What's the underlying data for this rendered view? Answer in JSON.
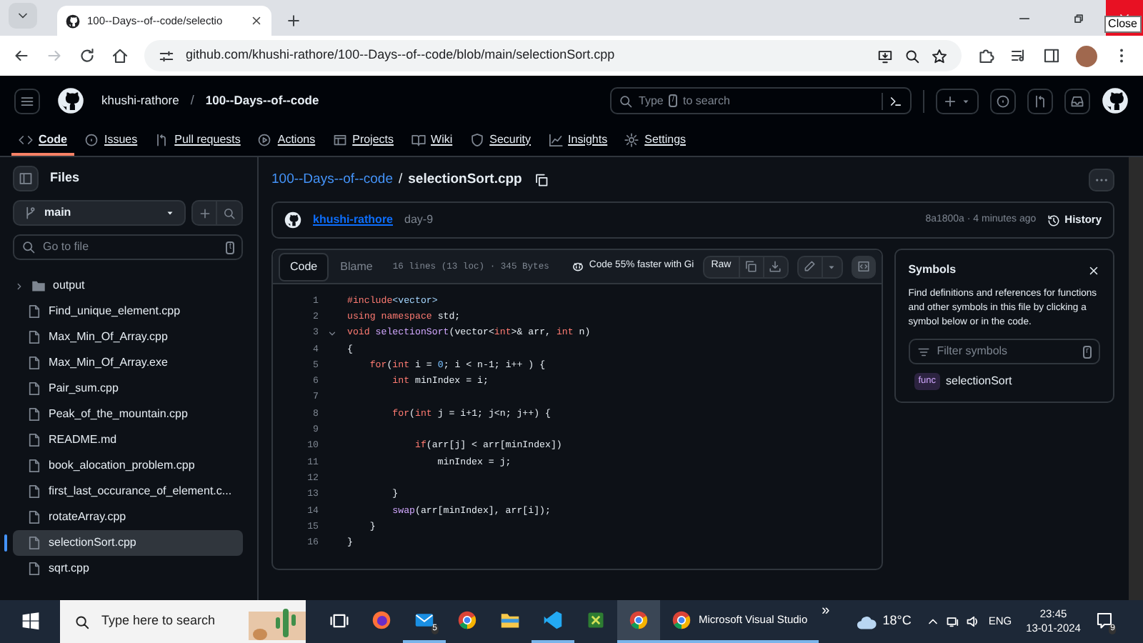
{
  "browser": {
    "tab_title": "100--Days--of--code/selectio",
    "url": "github.com/khushi-rathore/100--Days--of--code/blob/main/selectionSort.cpp",
    "close_tooltip": "Close"
  },
  "header": {
    "owner": "khushi-rathore",
    "separator": "/",
    "repo": "100--Days--of--code",
    "search": {
      "placeholder_before": "Type",
      "key": "/",
      "placeholder_after": "to search"
    }
  },
  "repo_tabs": [
    {
      "label": "Code",
      "selected": true
    },
    {
      "label": "Issues",
      "selected": false
    },
    {
      "label": "Pull requests",
      "selected": false
    },
    {
      "label": "Actions",
      "selected": false
    },
    {
      "label": "Projects",
      "selected": false
    },
    {
      "label": "Wiki",
      "selected": false
    },
    {
      "label": "Security",
      "selected": false
    },
    {
      "label": "Insights",
      "selected": false
    },
    {
      "label": "Settings",
      "selected": false
    }
  ],
  "sidebar": {
    "title": "Files",
    "branch": "main",
    "search": {
      "placeholder": "Go to file",
      "key": "t"
    },
    "tree": [
      {
        "name": "output",
        "kind": "folder",
        "expanded": false,
        "selected": false
      },
      {
        "name": "Find_unique_element.cpp",
        "kind": "file",
        "selected": false
      },
      {
        "name": "Max_Min_Of_Array.cpp",
        "kind": "file",
        "selected": false
      },
      {
        "name": "Max_Min_Of_Array.exe",
        "kind": "file",
        "selected": false
      },
      {
        "name": "Pair_sum.cpp",
        "kind": "file",
        "selected": false
      },
      {
        "name": "Peak_of_the_mountain.cpp",
        "kind": "file",
        "selected": false
      },
      {
        "name": "README.md",
        "kind": "file",
        "selected": false
      },
      {
        "name": "book_alocation_problem.cpp",
        "kind": "file",
        "selected": false
      },
      {
        "name": "first_last_occurance_of_element.c...",
        "kind": "file",
        "selected": false
      },
      {
        "name": "rotateArray.cpp",
        "kind": "file",
        "selected": false
      },
      {
        "name": "selectionSort.cpp",
        "kind": "file",
        "selected": true
      },
      {
        "name": "sqrt.cpp",
        "kind": "file",
        "selected": false
      }
    ]
  },
  "breadcrumb": {
    "repo": "100--Days--of--code",
    "separator": "/",
    "file": "selectionSort.cpp"
  },
  "commit": {
    "author": "khushi-rathore",
    "message": "day-9",
    "meta": "8a1800a · 4 minutes ago",
    "history": "History"
  },
  "file_view": {
    "tabs": [
      {
        "label": "Code",
        "selected": true
      },
      {
        "label": "Blame",
        "selected": false
      }
    ],
    "stats": "16 lines (13 loc) · 345 Bytes",
    "copilot": "Code 55% faster with Gi",
    "raw": "Raw",
    "lines": [
      {
        "number": "1",
        "tokens": [
          {
            "text": "#include",
            "kind": "keyword"
          },
          {
            "text": "<vector>",
            "kind": "string"
          }
        ]
      },
      {
        "number": "2",
        "tokens": [
          {
            "text": "using namespace",
            "kind": "keyword"
          },
          {
            "text": " std;",
            "kind": "plain"
          }
        ]
      },
      {
        "number": "3",
        "expanded": true,
        "tokens": [
          {
            "text": "void ",
            "kind": "keyword"
          },
          {
            "text": "selectionSort",
            "kind": "function"
          },
          {
            "text": "(vector<",
            "kind": "plain"
          },
          {
            "text": "int",
            "kind": "keyword"
          },
          {
            "text": ">& arr, ",
            "kind": "plain"
          },
          {
            "text": "int",
            "kind": "keyword"
          },
          {
            "text": " n)",
            "kind": "plain"
          }
        ]
      },
      {
        "number": "4",
        "tokens": [
          {
            "text": "{",
            "kind": "plain"
          }
        ]
      },
      {
        "number": "5",
        "tokens": [
          {
            "text": "    for",
            "kind": "keyword"
          },
          {
            "text": "(",
            "kind": "plain"
          },
          {
            "text": "int",
            "kind": "keyword"
          },
          {
            "text": " i = ",
            "kind": "plain"
          },
          {
            "text": "0",
            "kind": "number"
          },
          {
            "text": "; i < n-1; i++ ) {",
            "kind": "plain"
          }
        ]
      },
      {
        "number": "6",
        "tokens": [
          {
            "text": "        int",
            "kind": "keyword"
          },
          {
            "text": " minIndex = i;",
            "kind": "plain"
          }
        ]
      },
      {
        "number": "7"
      },
      {
        "number": "8",
        "tokens": [
          {
            "text": "        for",
            "kind": "keyword"
          },
          {
            "text": "(",
            "kind": "plain"
          },
          {
            "text": "int",
            "kind": "keyword"
          },
          {
            "text": " j = i+1; j<n; j++) {",
            "kind": "plain"
          }
        ]
      },
      {
        "number": "9"
      },
      {
        "number": "10",
        "tokens": [
          {
            "text": "            if",
            "kind": "keyword"
          },
          {
            "text": "(arr[j] < arr[minIndex])",
            "kind": "plain"
          }
        ]
      },
      {
        "number": "11",
        "tokens": [
          {
            "text": "                minIndex = j;",
            "kind": "plain"
          }
        ]
      },
      {
        "number": "12"
      },
      {
        "number": "13",
        "tokens": [
          {
            "text": "        }",
            "kind": "plain"
          }
        ]
      },
      {
        "number": "14",
        "tokens": [
          {
            "text": "        swap",
            "kind": "function"
          },
          {
            "text": "(arr[minIndex], arr[i]);",
            "kind": "plain"
          }
        ]
      },
      {
        "number": "15",
        "tokens": [
          {
            "text": "    }",
            "kind": "plain"
          }
        ]
      },
      {
        "number": "16",
        "tokens": [
          {
            "text": "}",
            "kind": "plain"
          }
        ]
      }
    ]
  },
  "symbols": {
    "title": "Symbols",
    "description": "Find definitions and references for functions and other symbols in this file by clicking a symbol below or in the code.",
    "filter": {
      "placeholder": "Filter symbols",
      "key": "r"
    },
    "items": [
      {
        "badge": "func",
        "name": "selectionSort"
      }
    ]
  },
  "taskbar": {
    "search_placeholder": "Type here to search",
    "apps": [
      {
        "kind": "taskview",
        "open": false,
        "selected": false
      },
      {
        "kind": "firefox",
        "open": false,
        "selected": false
      },
      {
        "kind": "mail",
        "open": true,
        "selected": false,
        "badge": "5"
      },
      {
        "kind": "chrome",
        "open": false,
        "selected": false
      },
      {
        "kind": "folder",
        "open": false,
        "selected": false
      },
      {
        "kind": "vscode",
        "open": true,
        "selected": false
      },
      {
        "kind": "sheet",
        "open": false,
        "selected": false
      },
      {
        "kind": "chrome",
        "open": true,
        "selected": true
      },
      {
        "kind": "chrome",
        "open": true,
        "selected": false,
        "label": "Microsoft Visual Studio"
      }
    ],
    "overflow": "»",
    "weather": "18°C",
    "language": "ENG",
    "time": "23:45",
    "date": "13-01-2024",
    "notifications": "9"
  }
}
